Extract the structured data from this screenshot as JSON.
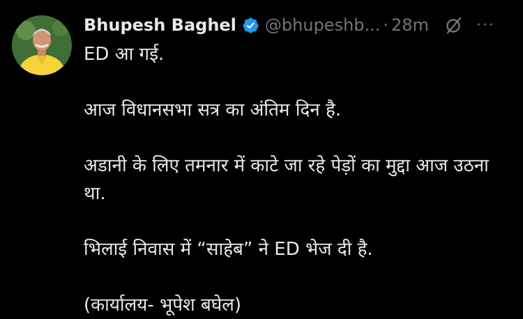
{
  "tweet": {
    "author_name": "Bhupesh Baghel",
    "handle": "@bhupeshb...",
    "separator": "·",
    "time": "28m",
    "more": "···",
    "verified_color": "#1d9bf0",
    "paragraphs": [
      "ED आ गई.",
      "आज विधानसभा सत्र का अंतिम दिन है.",
      "अडानी के लिए तमनार में काटे जा रहे पेड़ों का मुद्दा आज उठना था.",
      "भिलाई निवास में “साहेब” ने ED भेज दी है.",
      "(कार्यालय- भूपेश बघेल)"
    ]
  },
  "icons": {
    "verified": "verified-badge-icon",
    "grok": "grok-icon",
    "more": "more-icon"
  }
}
